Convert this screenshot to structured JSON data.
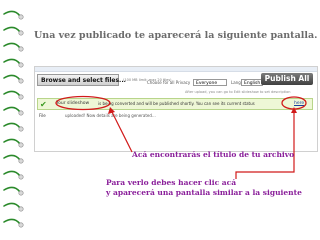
{
  "slide": {
    "title": "Una vez publicado te aparecerá la siguiente pantalla.",
    "annotation_file": "Acá encontrarás el título de tu archivo",
    "annotation_view_line1": "Para verlo debes hacer clic acá",
    "annotation_view_line2": "y aparecerá una pantalla similar a la siguiente",
    "annotation_color": "#8a1f9a",
    "callout_color": "#d11a1a"
  },
  "screenshot": {
    "browse_label": "Browse and select files...",
    "limit_text": "(100 MB limit; max 20 files)",
    "publish_label": "Publish All",
    "privacy_label": "Choose for all Privacy",
    "privacy_value": "Everyone",
    "language_label": "Lang",
    "language_value": "English",
    "hint_text": "After upload, you can go to Edit slideshow to set description",
    "notice_check_icon": "check-icon",
    "notice_name": "Your slideshow",
    "notice_text": "is being converted and will be published shortly. You can see its current status",
    "notice_link": "here",
    "file_label": "File",
    "file_status": "uploaded! Now details are being generated..."
  }
}
